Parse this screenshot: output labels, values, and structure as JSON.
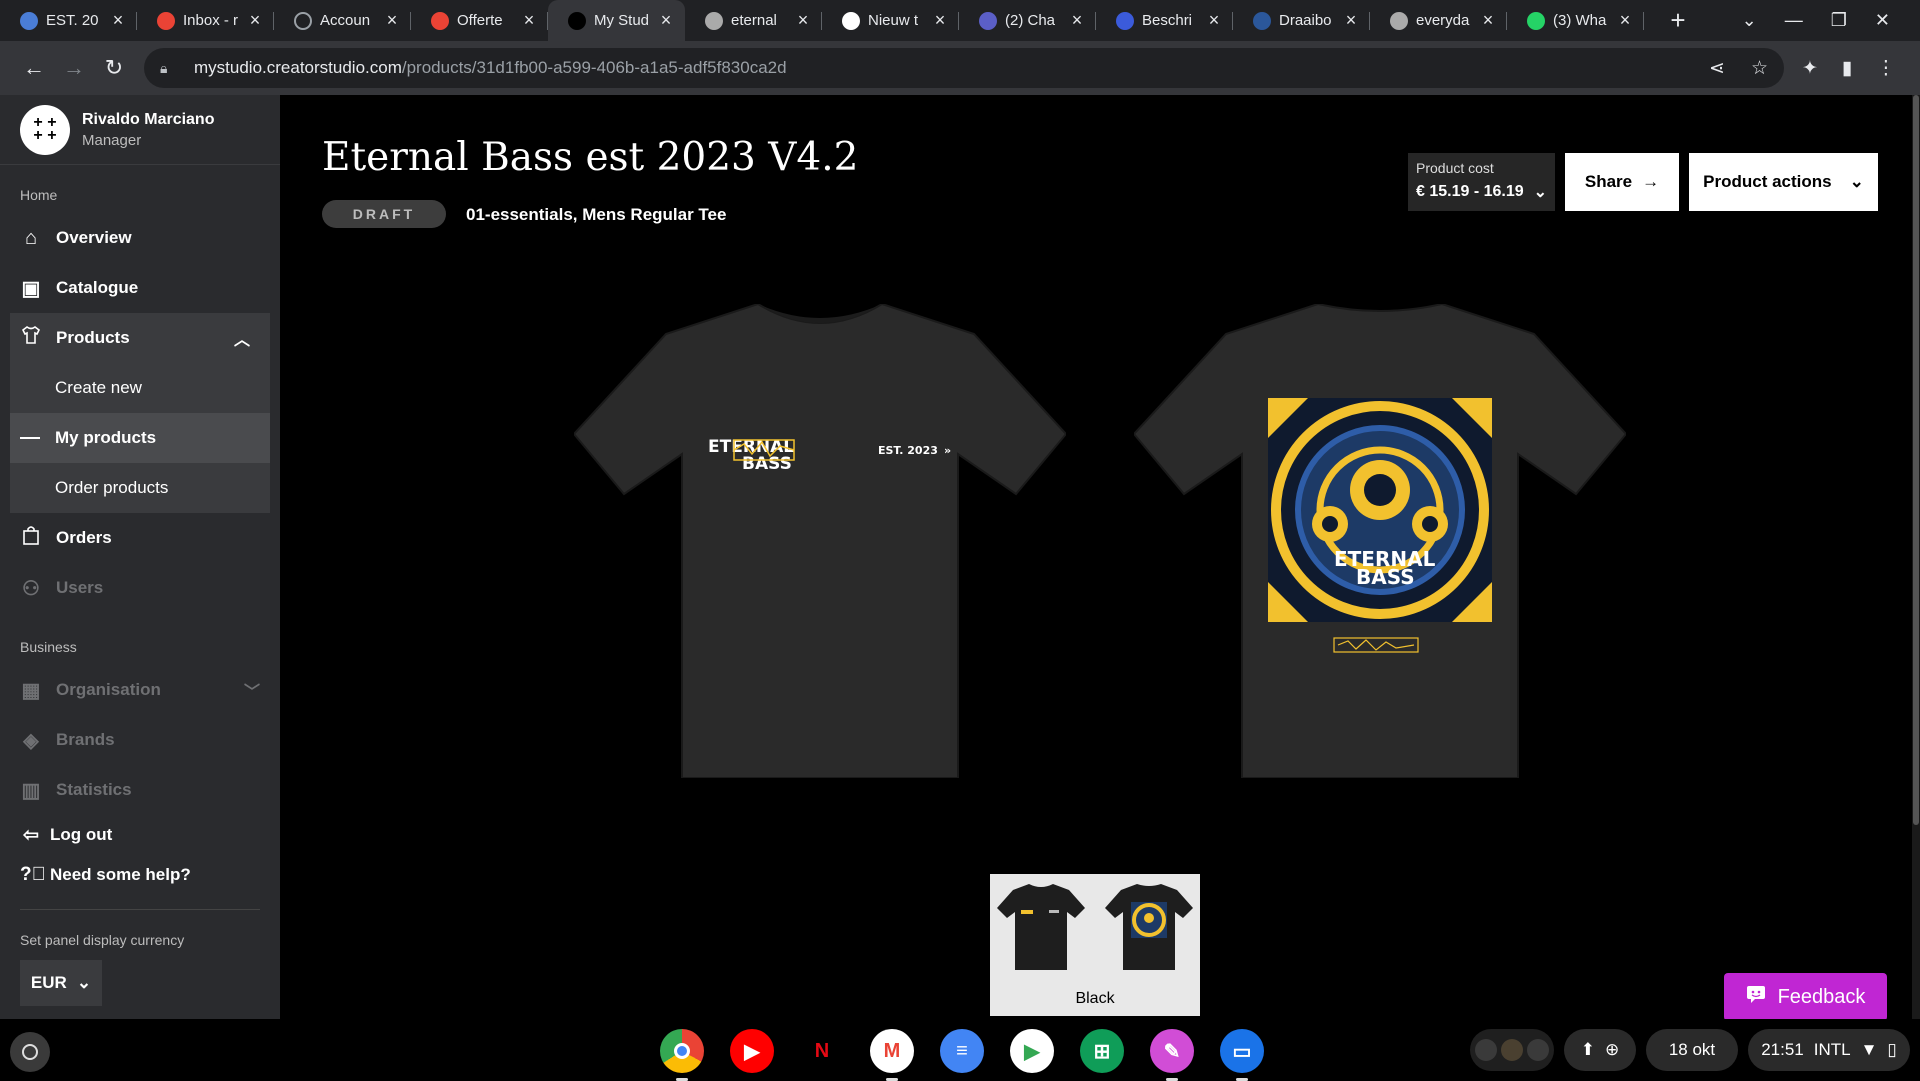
{
  "browser": {
    "tabs": [
      {
        "title": "EST. 20",
        "icon": "chrome-canary-icon",
        "color": "#4a7dd6"
      },
      {
        "title": "Inbox - r",
        "icon": "gmail-icon",
        "color": "#ea4335"
      },
      {
        "title": "Accoun",
        "icon": "loading-icon",
        "color": "#777777"
      },
      {
        "title": "Offerte",
        "icon": "gmail-icon",
        "color": "#ea4335"
      },
      {
        "title": "My Stud",
        "icon": "mystudio-icon",
        "color": "#000000",
        "active": true
      },
      {
        "title": "eternal",
        "icon": "globe-icon",
        "color": "#aaaaaa"
      },
      {
        "title": "Nieuw t",
        "icon": "chrome-icon",
        "color": "#ffffff"
      },
      {
        "title": "(2) Cha",
        "icon": "teams-icon",
        "color": "#5b5fc7"
      },
      {
        "title": "Beschri",
        "icon": "edge-icon",
        "color": "#3b5bdb"
      },
      {
        "title": "Draaibo",
        "icon": "word-icon",
        "color": "#2b579a"
      },
      {
        "title": "everyda",
        "icon": "globe-icon",
        "color": "#aaaaaa"
      },
      {
        "title": "(3) Wha",
        "icon": "whatsapp-icon",
        "color": "#25d366"
      }
    ],
    "url_host": "mystudio.creatorstudio.com",
    "url_path": "/products/31d1fb00-a599-406b-a1a5-adf5f830ca2d"
  },
  "sidebar": {
    "user_name": "Rivaldo Marciano",
    "user_role": "Manager",
    "section_home": "Home",
    "overview": "Overview",
    "catalogue": "Catalogue",
    "products": "Products",
    "create_new": "Create new",
    "my_products": "My products",
    "order_products": "Order products",
    "orders": "Orders",
    "users": "Users",
    "section_business": "Business",
    "organisation": "Organisation",
    "brands": "Brands",
    "statistics": "Statistics",
    "log_out": "Log out",
    "help": "Need some help?",
    "currency_label": "Set panel display currency",
    "currency_value": "EUR"
  },
  "product": {
    "title": "Eternal Bass est 2023 V4.2",
    "status": "DRAFT",
    "meta": "01-essentials, Mens Regular Tee",
    "cost_label": "Product cost",
    "cost_value": "€ 15.19 - 16.19",
    "share_label": "Share",
    "actions_label": "Product actions",
    "front_logo_line1": "ETERNAL",
    "front_logo_line2": "BASS",
    "front_est": "EST. 2023",
    "back_logo_line1": "ETERNAL",
    "back_logo_line2": "BASS",
    "variant_label": "Black",
    "shirt_color": "#2a2a2a",
    "accent": "#f2c12e"
  },
  "feedback": {
    "label": "Feedback"
  },
  "shelf": {
    "apps": [
      {
        "name": "chrome-app-icon",
        "glyph": "",
        "bg": "conic-gradient(#ea4335 0 33%, #fbbc05 0 66%, #34a853 0)",
        "running": true
      },
      {
        "name": "youtube-app-icon",
        "glyph": "▶",
        "bg": "#ff0000",
        "running": false
      },
      {
        "name": "netflix-app-icon",
        "glyph": "N",
        "bg": "#000000",
        "running": false
      },
      {
        "name": "gmail-app-icon",
        "glyph": "M",
        "bg": "#ffffff",
        "running": true
      },
      {
        "name": "docs-app-icon",
        "glyph": "≡",
        "bg": "#4285f4",
        "running": false
      },
      {
        "name": "play-store-app-icon",
        "glyph": "▶",
        "bg": "#ffffff",
        "running": false
      },
      {
        "name": "sheets-app-icon",
        "glyph": "⊞",
        "bg": "#0f9d58",
        "running": false
      },
      {
        "name": "canvas-app-icon",
        "glyph": "✎",
        "bg": "#d14dd6",
        "running": true
      },
      {
        "name": "files-app-icon",
        "glyph": "▭",
        "bg": "#1a73e8",
        "running": true
      }
    ],
    "date": "18 okt",
    "time": "21:51",
    "layout": "INTL"
  }
}
